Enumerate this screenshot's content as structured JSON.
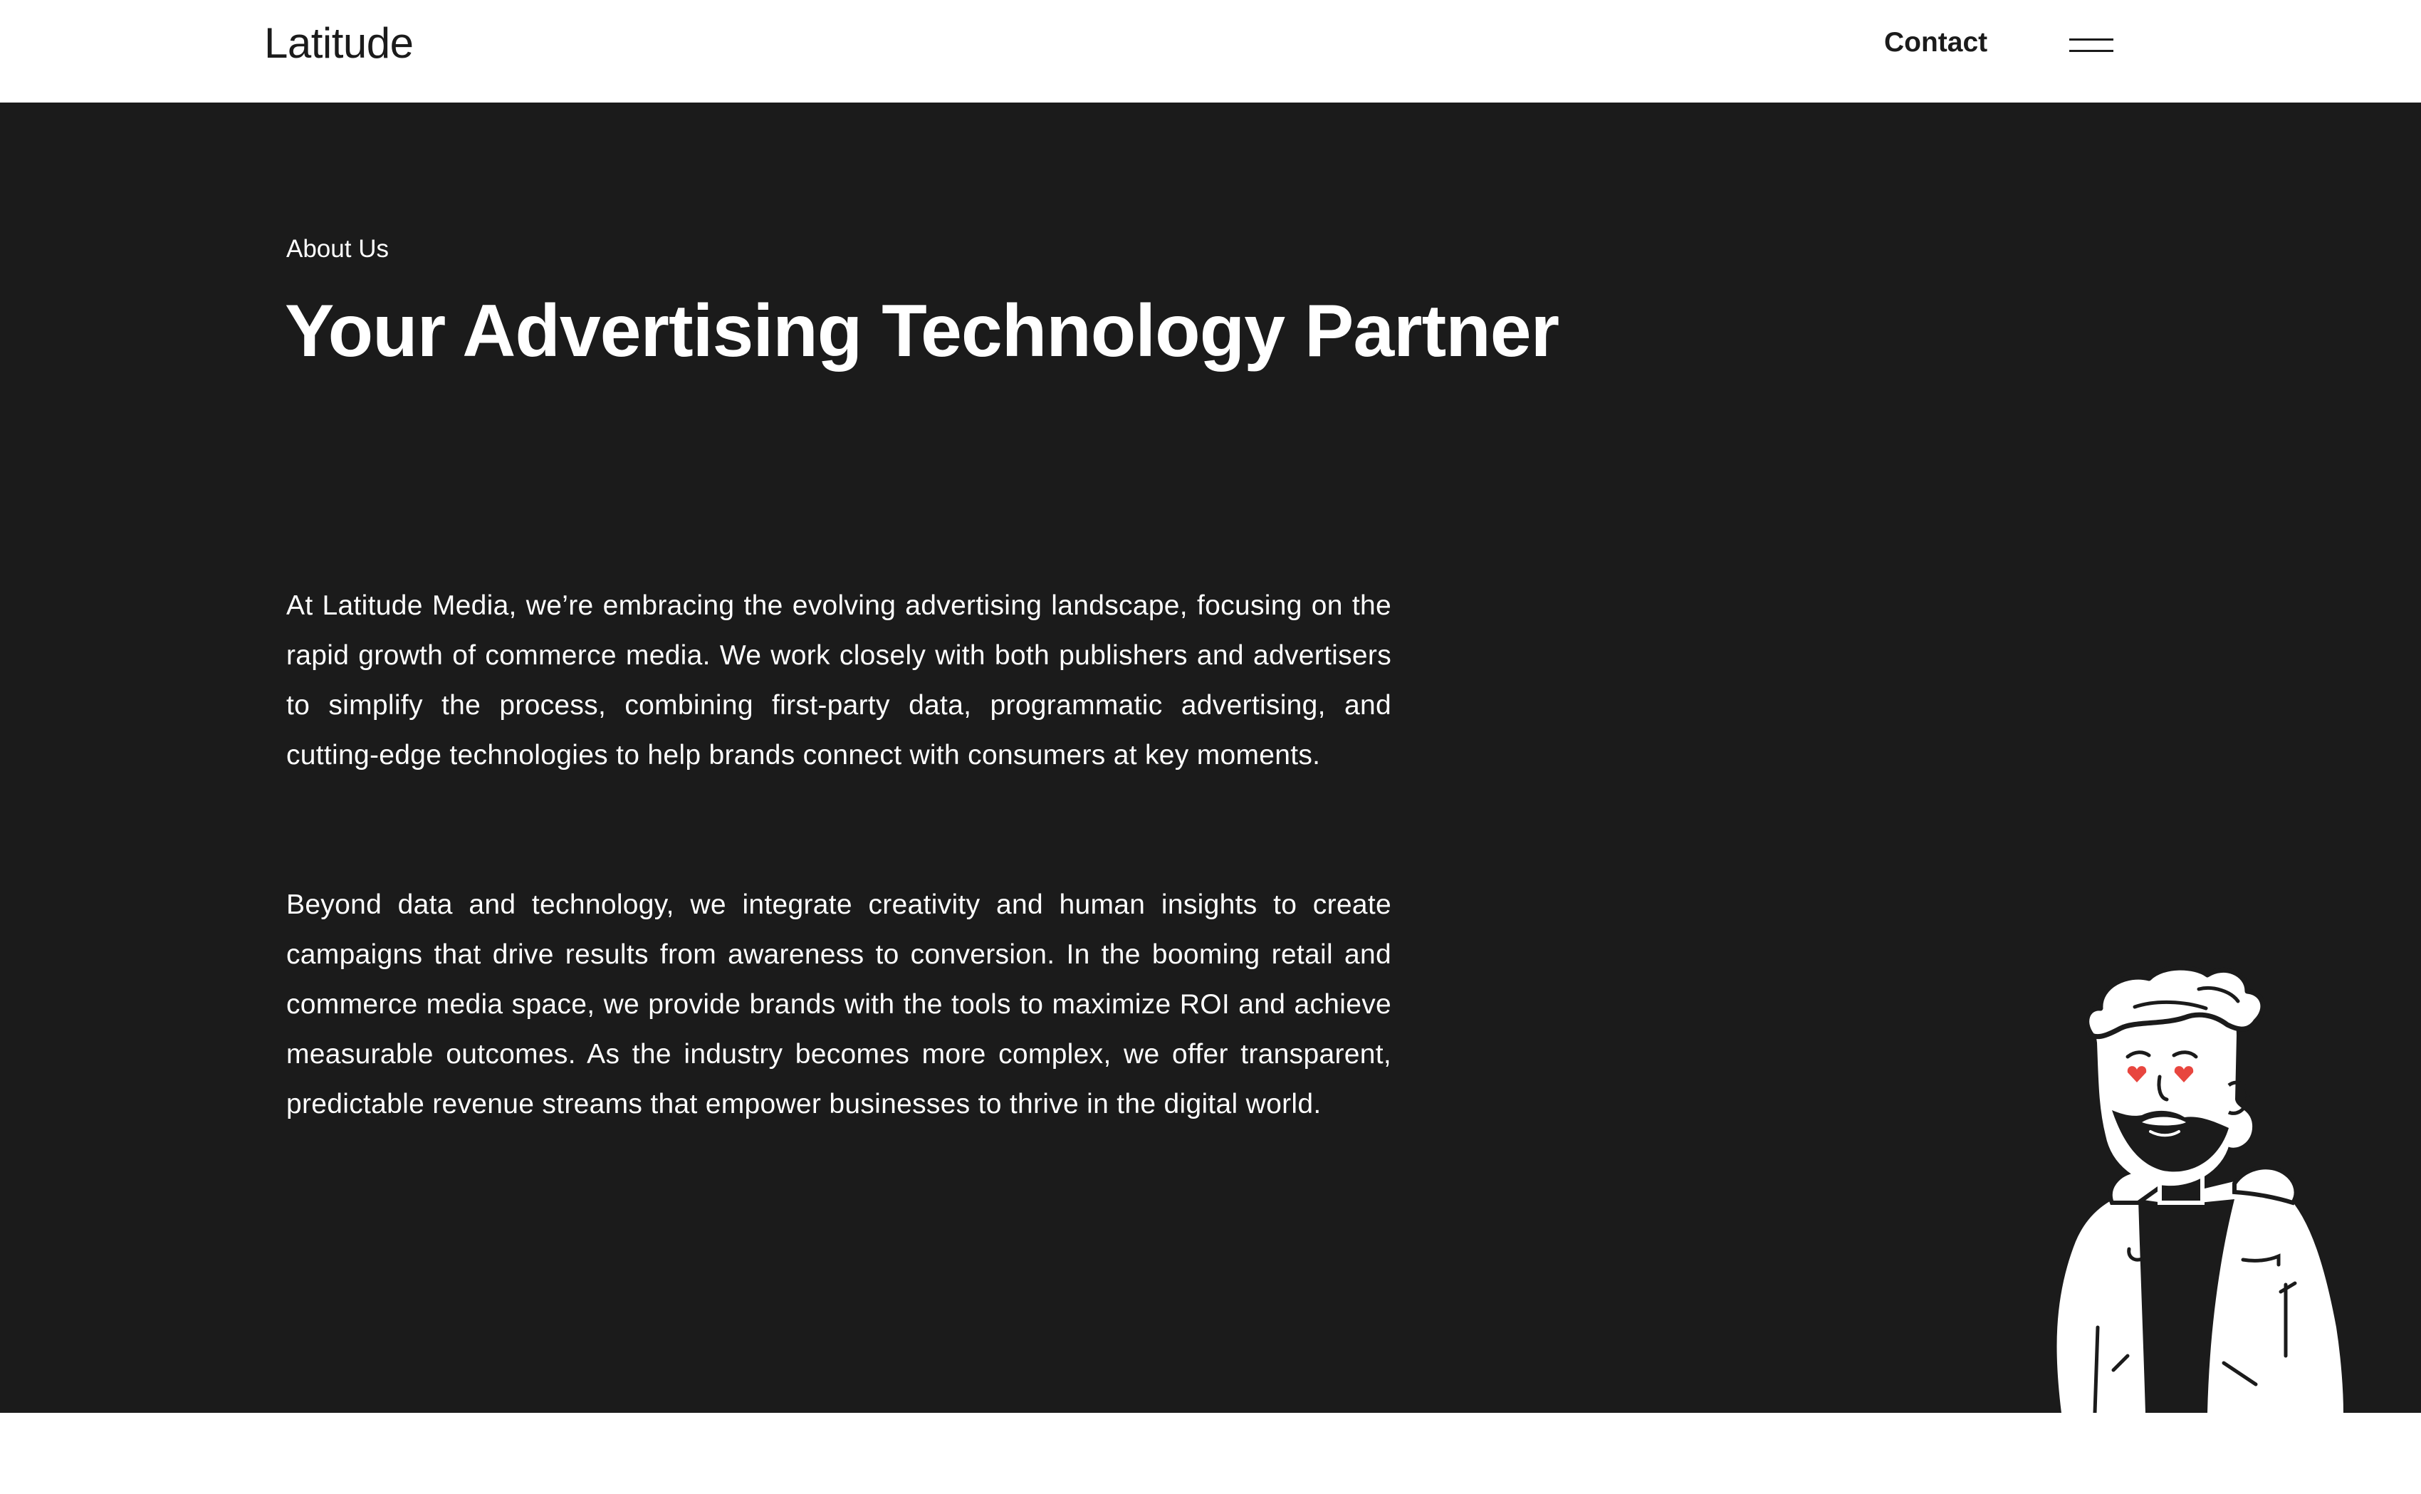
{
  "header": {
    "logo": "Latitude",
    "contact_label": "Contact"
  },
  "hero": {
    "eyebrow": "About Us",
    "title": "Your Advertising Technology Partner",
    "paragraphs": [
      "At Latitude Media, we’re embracing the evolving advertising landscape, focusing on the rapid growth of commerce media. We work closely with both publishers and advertisers to simplify the process, combining first-party data, programmatic advertising, and cutting-edge technologies to help brands connect with consumers at key moments.",
      "Beyond data and technology, we integrate creativity and human insights to create campaigns that drive results from awareness to conversion. In the booming retail and commerce media space, we provide brands with the tools to maximize ROI and achieve measurable outcomes. As the industry becomes more complex, we offer transparent, predictable revenue streams that empower businesses to thrive in the digital world."
    ]
  },
  "colors": {
    "dark_background": "#1b1b1b",
    "text_light": "#ffffff",
    "text_dark": "#1b1b1b",
    "accent_heart": "#e8463f"
  },
  "icons": {
    "menu": "hamburger-menu-icon",
    "illustration": "bearded-man-heart-eyes-illustration"
  }
}
